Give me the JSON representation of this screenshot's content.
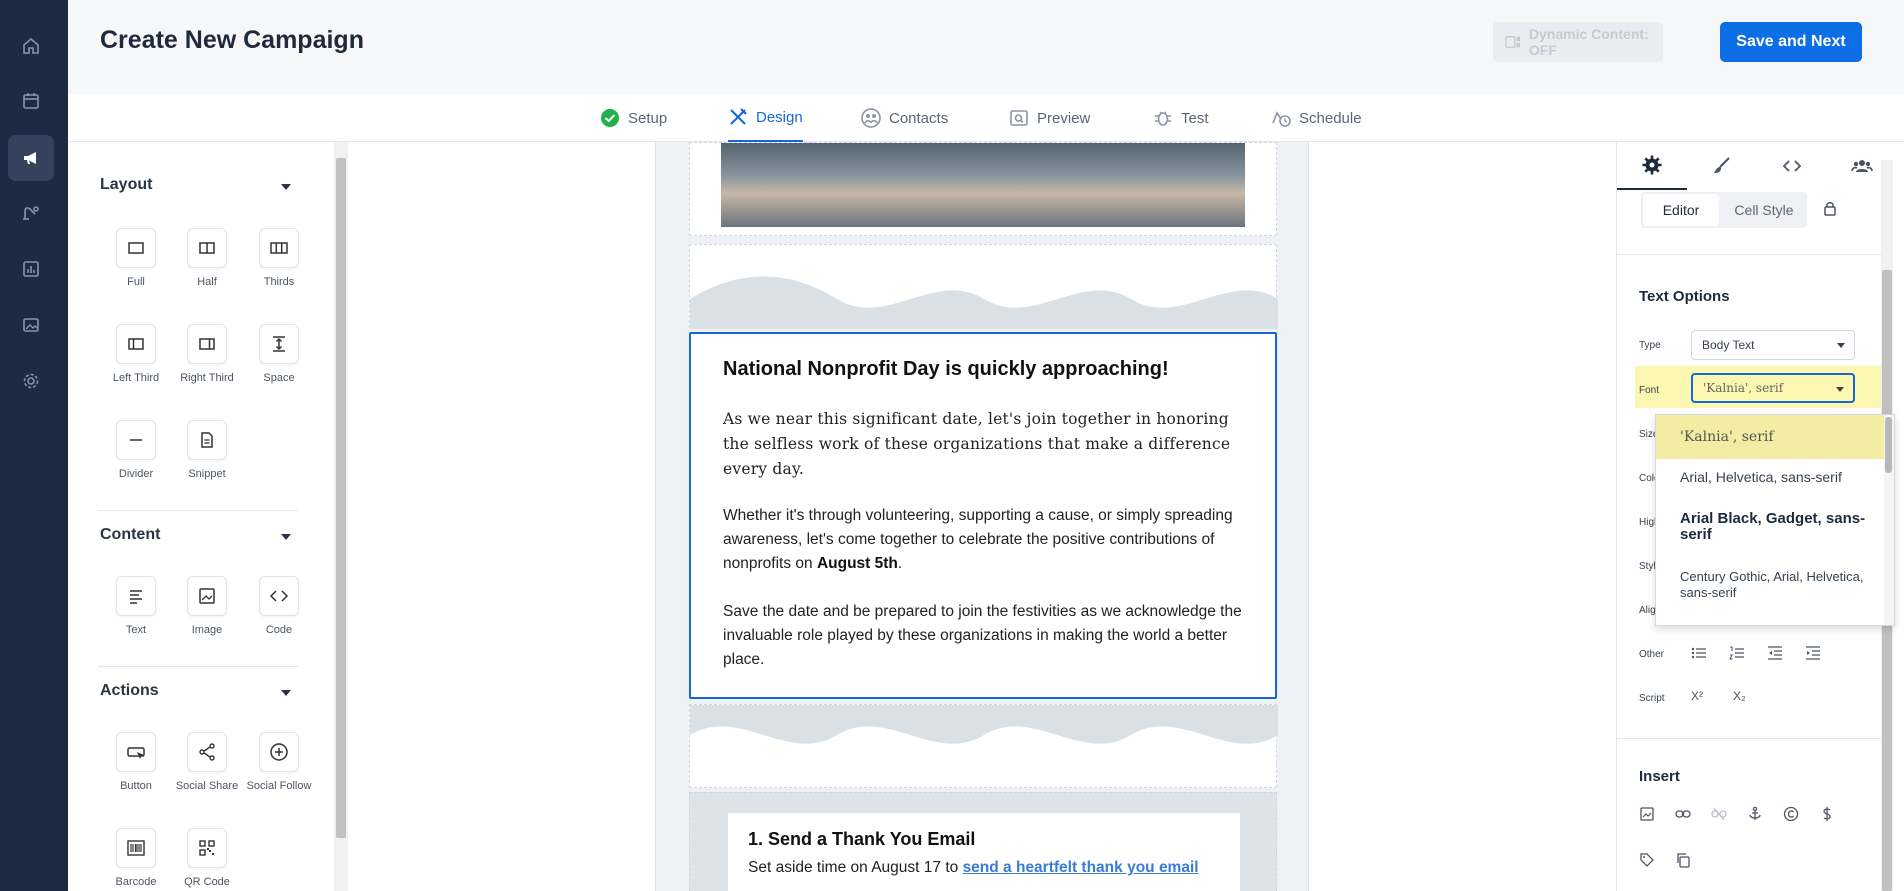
{
  "header": {
    "title": "Create New Campaign",
    "dynamic_content_label": "Dynamic Content: OFF",
    "save_next_label": "Save and Next"
  },
  "rail": {
    "items": [
      "home-icon",
      "calendar-icon",
      "megaphone-icon",
      "automation-icon",
      "reports-icon",
      "media-icon",
      "settings-icon"
    ],
    "active": "megaphone-icon"
  },
  "steps": [
    {
      "label": "Setup",
      "icon": "check-circle-icon",
      "status": "complete"
    },
    {
      "label": "Design",
      "icon": "design-tools-icon",
      "status": "active"
    },
    {
      "label": "Contacts",
      "icon": "contacts-icon",
      "status": "pending"
    },
    {
      "label": "Preview",
      "icon": "preview-icon",
      "status": "pending"
    },
    {
      "label": "Test",
      "icon": "bug-icon",
      "status": "pending"
    },
    {
      "label": "Schedule",
      "icon": "schedule-icon",
      "status": "pending"
    }
  ],
  "blocks_panel": {
    "layout_title": "Layout",
    "layout_items": [
      "Full",
      "Half",
      "Thirds",
      "Left Third",
      "Right Third",
      "Space",
      "Divider",
      "Snippet"
    ],
    "content_title": "Content",
    "content_items": [
      "Text",
      "Image",
      "Code"
    ],
    "actions_title": "Actions",
    "actions_items": [
      "Button",
      "Social Share",
      "Social Follow",
      "Barcode",
      "QR Code"
    ]
  },
  "email": {
    "heading": "National Nonprofit Day is quickly approaching!",
    "para1": "As we near this significant date, let's join together in honoring the selfless work of these organizations that make a difference every day.",
    "para2_pre": "Whether it's through volunteering, supporting a cause, or simply spreading awareness, let's come together to celebrate the positive contributions of nonprofits on ",
    "para2_bold": "August 5th",
    "para2_post": ".",
    "para3": "Save the date and be prepared to join the festivities as we acknowledge the invaluable role played by these organizations in making the world a better place.",
    "card_heading": "1. Send a Thank You Email",
    "card_text_pre": "Set aside time on August 17 to ",
    "card_link": "send a heartfelt thank you email"
  },
  "props_panel": {
    "tabs": [
      "gear-icon",
      "brush-icon",
      "code-icon",
      "people-icon"
    ],
    "segment_editor": "Editor",
    "segment_cell_style": "Cell Style",
    "text_options_title": "Text Options",
    "type_label": "Type",
    "type_value": "Body Text",
    "font_label": "Font",
    "font_value": "'Kalnia', serif",
    "size_label": "Size",
    "color_label": "Color",
    "highlight_label": "Highlight",
    "style_label": "Style",
    "align_label": "Align",
    "other_label": "Other",
    "script_label": "Script",
    "script_super": "X²",
    "script_sub": "X₂",
    "insert_title": "Insert"
  },
  "font_dropdown": {
    "options": [
      "'Kalnia', serif",
      "Arial, Helvetica, sans-serif",
      "Arial Black, Gadget, sans-serif",
      "Century Gothic, Arial, Helvetica, sans-serif"
    ],
    "selected": "'Kalnia', serif"
  }
}
